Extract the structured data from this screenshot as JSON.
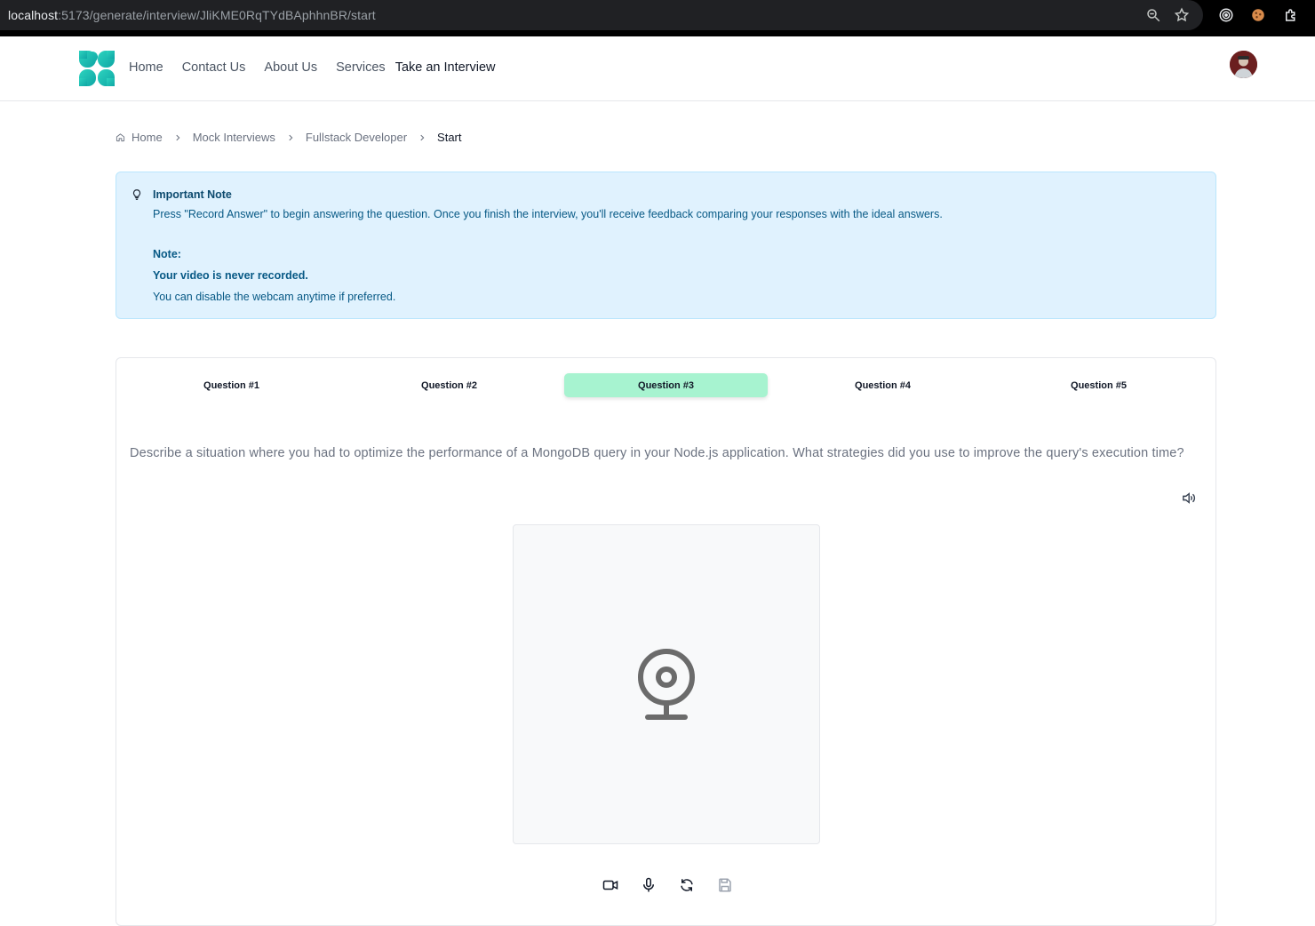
{
  "browser": {
    "url_host": "localhost",
    "url_path": ":5173/generate/interview/JliKME0RqTYdBAphhnBR/start",
    "icons": [
      "zoom-icon",
      "bookmark-star-icon",
      "extension-target-icon",
      "cookie-icon",
      "extensions-puzzle-icon"
    ]
  },
  "header": {
    "nav": {
      "home": "Home",
      "contact": "Contact Us",
      "about": "About Us",
      "services": "Services",
      "interview": "Take an Interview"
    },
    "brand_color": "#14b8a6"
  },
  "breadcrumb": {
    "home": "Home",
    "mock": "Mock Interviews",
    "role": "Fullstack Developer",
    "current": "Start"
  },
  "note": {
    "title": "Important Note",
    "message": "Press \"Record Answer\" to begin answering the question. Once you finish the interview, you'll receive feedback comparing your responses with the ideal answers.",
    "subtitle": "Note:",
    "privacy": "Your video is never recorded.",
    "webcam_hint": "You can disable the webcam anytime if preferred.",
    "colors": {
      "background": "#e0f2fe",
      "text": "#075985"
    }
  },
  "interview": {
    "tabs": [
      "Question #1",
      "Question #2",
      "Question #3",
      "Question #4",
      "Question #5"
    ],
    "active_tab_index": 2,
    "active_color": "#a7f3d0",
    "question": "Describe a situation where you had to optimize the performance of a MongoDB query in your Node.js application. What strategies did you use to improve the query's execution time?",
    "controls": [
      "video-camera-icon",
      "microphone-icon",
      "refresh-icon",
      "save-icon"
    ]
  }
}
